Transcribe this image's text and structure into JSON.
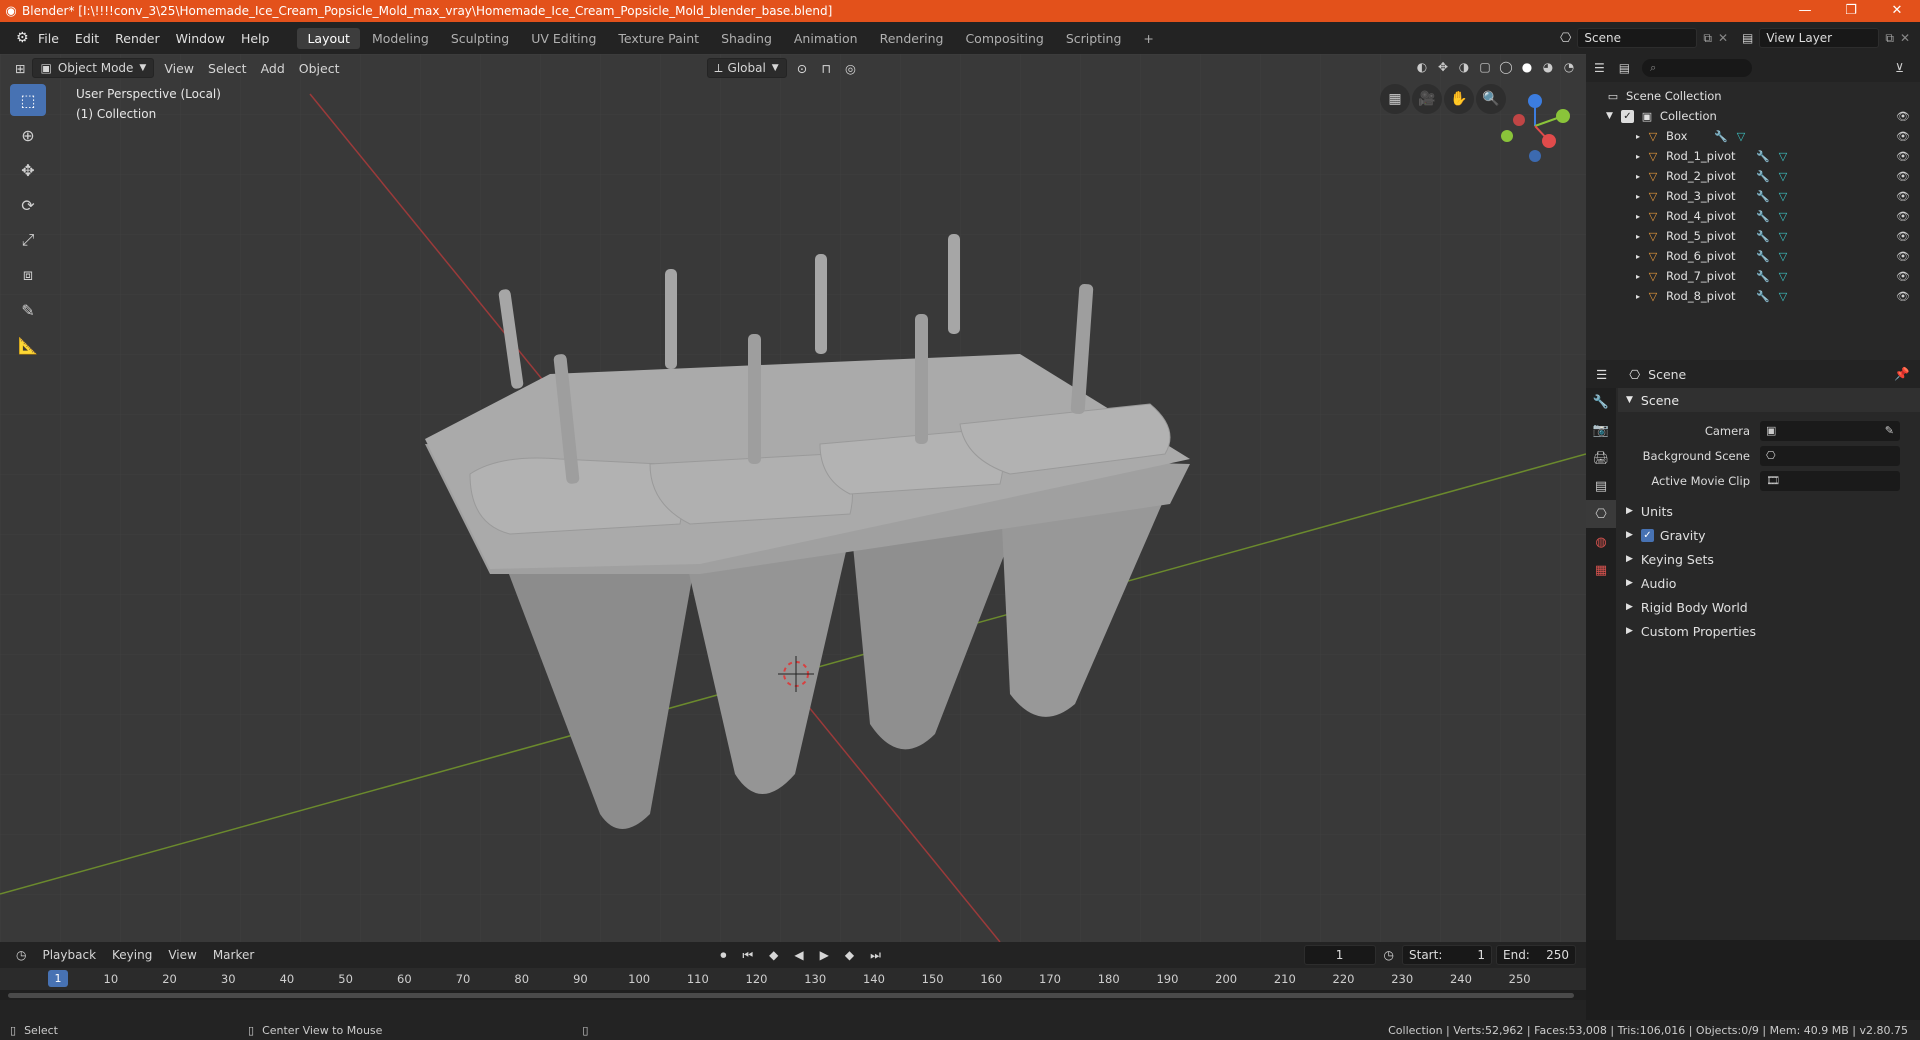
{
  "window": {
    "title": "Blender* [I:\\!!!!conv_3\\25\\Homemade_Ice_Cream_Popsicle_Mold_max_vray\\Homemade_Ice_Cream_Popsicle_Mold_blender_base.blend]",
    "controls": [
      "—",
      "❐",
      "✕"
    ]
  },
  "menu": [
    "File",
    "Edit",
    "Render",
    "Window",
    "Help"
  ],
  "workspaces": [
    "Layout",
    "Modeling",
    "Sculpting",
    "UV Editing",
    "Texture Paint",
    "Shading",
    "Animation",
    "Rendering",
    "Compositing",
    "Scripting"
  ],
  "active_workspace": "Layout",
  "scene_field": "Scene",
  "view_layer_field": "View Layer",
  "viewport": {
    "mode": "Object Mode",
    "menus": [
      "View",
      "Select",
      "Add",
      "Object"
    ],
    "transform_orientation": "Global",
    "info_line1": "User Perspective (Local)",
    "info_line2": "(1) Collection"
  },
  "outliner": {
    "search_placeholder": "",
    "scene_collection": "Scene Collection",
    "collection": "Collection",
    "objects": [
      "Box",
      "Rod_1_pivot",
      "Rod_2_pivot",
      "Rod_3_pivot",
      "Rod_4_pivot",
      "Rod_5_pivot",
      "Rod_6_pivot",
      "Rod_7_pivot",
      "Rod_8_pivot"
    ]
  },
  "properties": {
    "header": "Scene",
    "panel": "Scene",
    "camera_label": "Camera",
    "background_scene_label": "Background Scene",
    "active_movie_clip_label": "Active Movie Clip",
    "subpanels": [
      "Units",
      "Gravity",
      "Keying Sets",
      "Audio",
      "Rigid Body World",
      "Custom Properties"
    ]
  },
  "timeline": {
    "menus": [
      "Playback",
      "Keying",
      "View",
      "Marker"
    ],
    "current_frame": "1",
    "start_label": "Start:",
    "start": "1",
    "end_label": "End:",
    "end": "250",
    "ticks": [
      "1",
      "10",
      "20",
      "30",
      "40",
      "50",
      "60",
      "70",
      "80",
      "90",
      "100",
      "110",
      "120",
      "130",
      "140",
      "150",
      "160",
      "170",
      "180",
      "190",
      "200",
      "210",
      "220",
      "230",
      "240",
      "250"
    ]
  },
  "statusbar": {
    "left": "Select",
    "middle": "Center View to Mouse",
    "right": "Collection | Verts:52,962 | Faces:53,008 | Tris:106,016 | Objects:0/9 | Mem: 40.9 MB | v2.80.75"
  },
  "colors": {
    "titlebar": "#e3511b",
    "accent": "#4772b3",
    "viewport_bg": "#393939"
  }
}
